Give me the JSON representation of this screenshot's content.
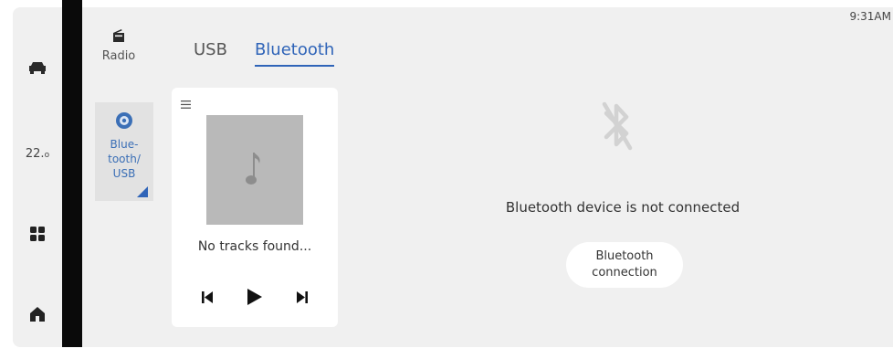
{
  "status_bar": {
    "time": "9:31AM"
  },
  "left_rail": {
    "temperature": "22.",
    "temperature_unit": "o"
  },
  "sources": {
    "radio_label": "Radio",
    "bluetooth_usb_label_lines": [
      "Blue-",
      "tooth/",
      "USB"
    ]
  },
  "tabs": [
    {
      "label": "USB",
      "active": false
    },
    {
      "label": "Bluetooth",
      "active": true
    }
  ],
  "player": {
    "status_text": "No tracks found..."
  },
  "bluetooth_panel": {
    "message": "Bluetooth device is not connected",
    "connect_button_lines": [
      "Bluetooth",
      "connection"
    ]
  },
  "colors": {
    "accent": "#2f64b8",
    "panel_bg": "#f0f0f0",
    "card_bg": "#ffffff",
    "album_placeholder": "#b9b9b9"
  },
  "icons": {
    "rail": [
      "car-icon",
      "temperature-readout",
      "apps-grid-icon",
      "home-icon"
    ],
    "sources": [
      "radio-icon",
      "bluetooth-usb-disc-icon"
    ],
    "player": [
      "menu-icon",
      "music-note-icon",
      "previous-track-icon",
      "play-icon",
      "next-track-icon"
    ],
    "bluetooth": "bluetooth-disabled-icon"
  }
}
